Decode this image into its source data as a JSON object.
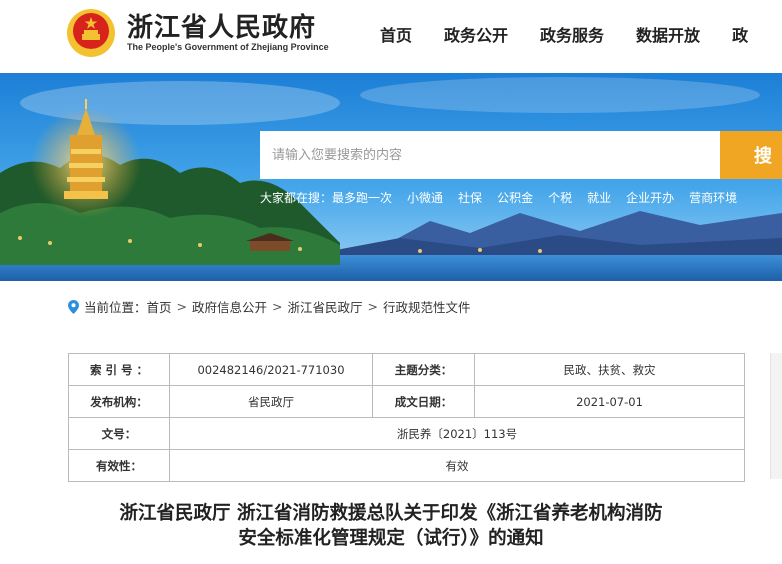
{
  "header": {
    "title_cn": "浙江省人民政府",
    "title_en": "The People's Government of Zhejiang Province",
    "nav": [
      "首页",
      "政务公开",
      "政务服务",
      "数据开放",
      "政"
    ]
  },
  "search": {
    "placeholder": "请输入您要搜索的内容",
    "button_label": "搜",
    "hot_label": "大家都在搜：",
    "hot_items": [
      "最多跑一次",
      "小微通",
      "社保",
      "公积金",
      "个税",
      "就业",
      "企业开办",
      "营商环境"
    ]
  },
  "breadcrumb": {
    "label": "当前位置：",
    "items": [
      "首页",
      "政府信息公开",
      "浙江省民政厅",
      "行政规范性文件"
    ],
    "separator": ">"
  },
  "info": {
    "index_label": "索 引 号 ：",
    "index_value": "002482146/2021-771030",
    "category_label": "主题分类：",
    "category_value": "民政、扶贫、救灾",
    "publisher_label": "发布机构：",
    "publisher_value": "省民政厅",
    "date_label": "成文日期：",
    "date_value": "2021-07-01",
    "doc_label": "文号：",
    "doc_value": "浙民养〔2021〕113号",
    "validity_label": "有效性：",
    "validity_value": "有效"
  },
  "article": {
    "title_line1": "浙江省民政厅 浙江省消防救援总队关于印发《浙江省养老机构消防",
    "title_line2": "安全标准化管理规定（试行）》的通知"
  },
  "colors": {
    "accent": "#f0a623",
    "emblem_red": "#d8221c",
    "emblem_gold": "#f2c230",
    "pin_blue": "#2b8fe0"
  }
}
